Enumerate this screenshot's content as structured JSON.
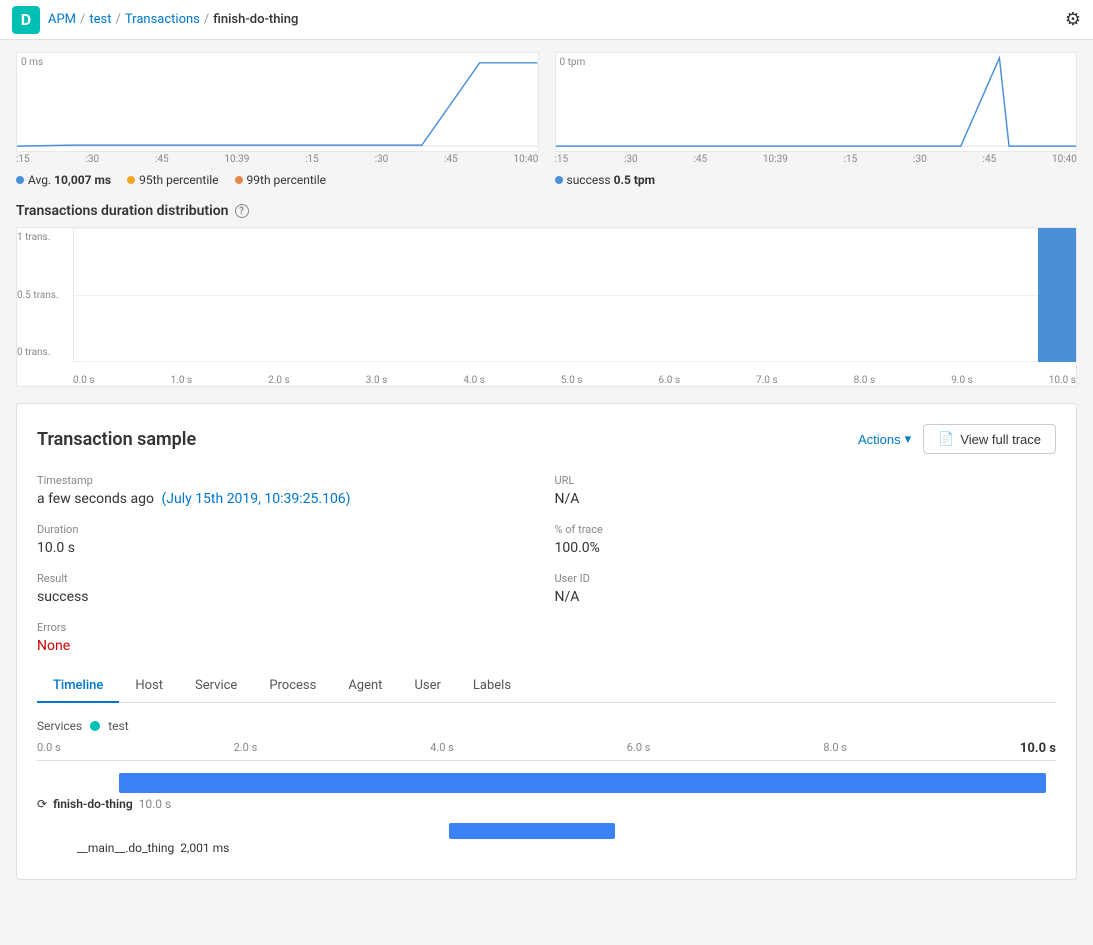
{
  "topbar": {
    "app_label": "D",
    "breadcrumb": [
      "APM",
      "test",
      "Transactions",
      "finish-do-thing"
    ]
  },
  "charts": {
    "left": {
      "y_label": "0 ms",
      "x_labels": [
        ":15",
        ":30",
        ":45",
        "10:39",
        ":15",
        ":30",
        ":45",
        "10:40"
      ],
      "legend": [
        {
          "color": "#4a90d9",
          "label": "Avg.",
          "value": "10,007 ms"
        },
        {
          "color": "#f5a623",
          "label": "95th percentile",
          "value": ""
        },
        {
          "color": "#e8854a",
          "label": "99th percentile",
          "value": ""
        }
      ]
    },
    "right": {
      "y_label": "0 tpm",
      "x_labels": [
        ":15",
        ":30",
        ":45",
        "10:39",
        ":15",
        ":30",
        ":45",
        "10:40"
      ],
      "legend": [
        {
          "color": "#4a90d9",
          "label": "success",
          "value": "0.5 tpm"
        }
      ]
    }
  },
  "distribution": {
    "title": "Transactions duration distribution",
    "y_labels": [
      "1 trans.",
      "0.5 trans.",
      "0 trans."
    ],
    "x_labels": [
      "0.0 s",
      "1.0 s",
      "2.0 s",
      "3.0 s",
      "4.0 s",
      "5.0 s",
      "6.0 s",
      "7.0 s",
      "8.0 s",
      "9.0 s",
      "10.0 s"
    ]
  },
  "sample": {
    "title": "Transaction sample",
    "actions_label": "Actions",
    "view_trace_label": "View full trace",
    "fields": {
      "timestamp_label": "Timestamp",
      "timestamp_value": "a few seconds ago",
      "timestamp_link": "(July 15th 2019, 10:39:25.106)",
      "url_label": "URL",
      "url_value": "N/A",
      "duration_label": "Duration",
      "duration_value": "10.0 s",
      "trace_label": "% of trace",
      "trace_value": "100.0%",
      "result_label": "Result",
      "result_value": "success",
      "userid_label": "User ID",
      "userid_value": "N/A",
      "errors_label": "Errors",
      "errors_value": "None"
    },
    "tabs": [
      "Timeline",
      "Host",
      "Service",
      "Process",
      "Agent",
      "User",
      "Labels"
    ],
    "active_tab": "Timeline",
    "timeline": {
      "services_label": "Services",
      "service_name": "test",
      "ruler": [
        "0.0 s",
        "2.0 s",
        "4.0 s",
        "6.0 s",
        "8.0 s",
        "10.0 s"
      ],
      "main_bar": {
        "name": "finish-do-thing",
        "duration": "10.0 s",
        "color": "#3b82f6",
        "left_pct": 8,
        "width_pct": 91
      },
      "sub_bar": {
        "name": "__main__.do_thing",
        "duration": "2,001 ms",
        "color": "#3b82f6",
        "left_pct": 38,
        "width_pct": 17
      }
    }
  }
}
